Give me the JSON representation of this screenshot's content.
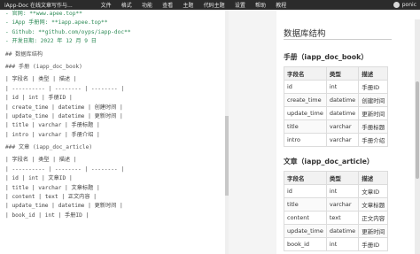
{
  "menubar": {
    "app_title": "iApp-Doc 在线文章写作与...",
    "items": [
      "文件",
      "格式",
      "功能",
      "查看",
      "主题",
      "代码主题",
      "设置",
      "帮助",
      "教程"
    ],
    "user_name": "ponic"
  },
  "editor": {
    "lines": [
      "- 官网: **www.apee.top**",
      "- iApp 手册网: **iapp.apee.top**",
      "- Github: **github.com/oyps/iapp-doc**",
      "- 开发日期: 2022 年 12 月 9 日",
      "## 数据库结构",
      "### 手册 (iapp_doc_book)",
      "| 字段名 | 类型 | 描述 |",
      "| ---------- | -------- | -------- |",
      "| id | int | 手册ID |",
      "| create_time | datetime | 创建时间 |",
      "| update_time | datetime | 更新时间 |",
      "| title | varchar | 手册标题 |",
      "| intro | varchar | 手册介绍 |",
      "### 文章 (iapp_doc_article)",
      "| 字段名 | 类型 | 描述 |",
      "| ---------- | -------- | -------- |",
      "| id | int | 文章ID |",
      "| title | varchar | 文章标题 |",
      "| content | text | 正文内容 |",
      "| update_time | datetime | 更新时间 |",
      "| book_id | int | 手册ID |"
    ]
  },
  "preview": {
    "h2": "数据库结构",
    "book": {
      "heading": "手册（iapp_doc_book）",
      "headers": [
        "字段名",
        "类型",
        "描述"
      ],
      "rows": [
        [
          "id",
          "int",
          "手册ID"
        ],
        [
          "create_time",
          "datetime",
          "创建时间"
        ],
        [
          "update_time",
          "datetime",
          "更新时间"
        ],
        [
          "title",
          "varchar",
          "手册标题"
        ],
        [
          "intro",
          "varchar",
          "手册介绍"
        ]
      ]
    },
    "article": {
      "heading": "文章（iapp_doc_article）",
      "headers": [
        "字段名",
        "类型",
        "描述"
      ],
      "rows": [
        [
          "id",
          "int",
          "文章ID"
        ],
        [
          "title",
          "varchar",
          "文章标题"
        ],
        [
          "content",
          "text",
          "正文内容"
        ],
        [
          "update_time",
          "datetime",
          "更新时间"
        ],
        [
          "book_id",
          "int",
          "手册ID"
        ]
      ]
    }
  }
}
